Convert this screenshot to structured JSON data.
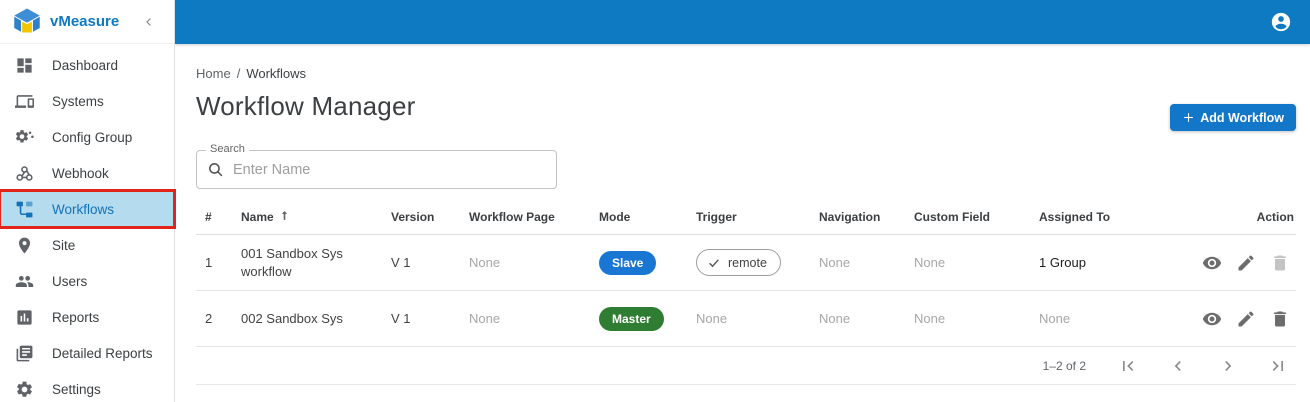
{
  "brand": {
    "name": "vMeasure",
    "accent_color": "#0d7ac4"
  },
  "sidebar": {
    "collapse_icon": "chevron-left-icon",
    "items": [
      {
        "label": "Dashboard",
        "icon": "dashboard"
      },
      {
        "label": "Systems",
        "icon": "systems"
      },
      {
        "label": "Config Group",
        "icon": "config-group"
      },
      {
        "label": "Webhook",
        "icon": "webhook"
      },
      {
        "label": "Workflows",
        "icon": "workflows",
        "active": true,
        "annotated": true
      },
      {
        "label": "Site",
        "icon": "site"
      },
      {
        "label": "Users",
        "icon": "users"
      },
      {
        "label": "Reports",
        "icon": "reports"
      },
      {
        "label": "Detailed Reports",
        "icon": "detailed-reports"
      },
      {
        "label": "Settings",
        "icon": "settings"
      }
    ]
  },
  "breadcrumb": {
    "items": [
      "Home",
      "Workflows"
    ],
    "separator": "/"
  },
  "page": {
    "title": "Workflow Manager"
  },
  "toolbar": {
    "add_workflow_label": "Add Workflow"
  },
  "search": {
    "label": "Search",
    "placeholder": "Enter Name",
    "value": ""
  },
  "table": {
    "columns": [
      {
        "label": "#"
      },
      {
        "label": "Name",
        "sorted": "asc"
      },
      {
        "label": "Version"
      },
      {
        "label": "Workflow Page"
      },
      {
        "label": "Mode"
      },
      {
        "label": "Trigger"
      },
      {
        "label": "Navigation"
      },
      {
        "label": "Custom Field"
      },
      {
        "label": "Assigned To"
      },
      {
        "label": "Action",
        "align": "right"
      }
    ],
    "rows": [
      {
        "num": "1",
        "name": "001 Sandbox Sys workflow",
        "version": "V 1",
        "workflow_page": {
          "label": "None",
          "muted": true
        },
        "mode": {
          "label": "Slave",
          "type": "badge",
          "color": "#1976d2"
        },
        "trigger": {
          "label": "remote",
          "type": "chip"
        },
        "navigation": {
          "label": "None",
          "muted": true
        },
        "custom_field": {
          "label": "None",
          "muted": true
        },
        "assigned_to": {
          "label": "1 Group",
          "muted": false
        },
        "actions": {
          "view": true,
          "edit": true,
          "delete": true,
          "delete_disabled": true
        }
      },
      {
        "num": "2",
        "name": "002 Sandbox Sys",
        "version": "V 1",
        "workflow_page": {
          "label": "None",
          "muted": true
        },
        "mode": {
          "label": "Master",
          "type": "badge",
          "color": "#2e7d32"
        },
        "trigger": {
          "label": "None",
          "type": "text",
          "muted": true
        },
        "navigation": {
          "label": "None",
          "muted": true
        },
        "custom_field": {
          "label": "None",
          "muted": true
        },
        "assigned_to": {
          "label": "None",
          "muted": true
        },
        "actions": {
          "view": true,
          "edit": true,
          "delete": true,
          "delete_disabled": false
        }
      }
    ]
  },
  "pagination": {
    "range_label": "1–2 of 2"
  },
  "status_colors": {
    "slave": "#1976d2",
    "master": "#2e7d32",
    "annotation_red": "#e1251b"
  }
}
